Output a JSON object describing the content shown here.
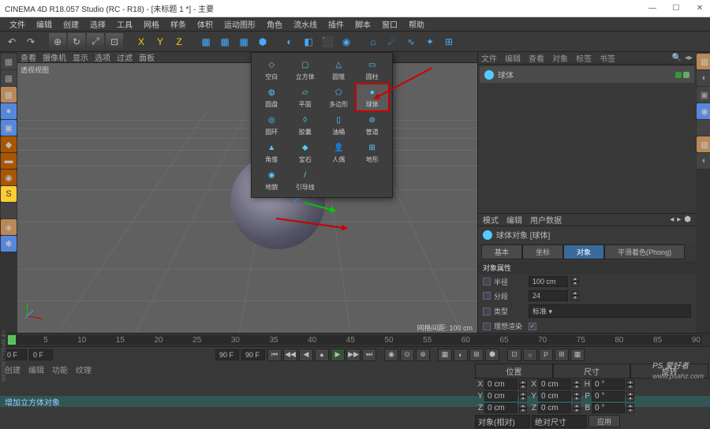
{
  "title": "CINEMA 4D R18.057 Studio (RC - R18) - [未标题 1 *] - 主要",
  "winbtns": {
    "min": "—",
    "max": "☐",
    "close": "✕"
  },
  "menus": [
    "文件",
    "编辑",
    "创建",
    "选择",
    "工具",
    "网格",
    "样条",
    "体积",
    "运动图形",
    "角色",
    "流水线",
    "插件",
    "脚本",
    "窗口",
    "帮助"
  ],
  "toolbar_icons": [
    "↶",
    "↷",
    "",
    "⊕",
    "↻",
    "⤢",
    "⊡",
    "",
    "X",
    "Y",
    "Z",
    "",
    "▦",
    "▦",
    "▦",
    "⬢",
    "",
    "◐",
    "◧",
    "⬛",
    "◉",
    "",
    "⌂",
    "☄",
    "∿",
    "✦",
    "⊞"
  ],
  "left_icons": [
    {
      "c": "c1",
      "t": "▦"
    },
    {
      "c": "c1",
      "t": "▦"
    },
    {
      "c": "c2",
      "t": "▦"
    },
    {
      "c": "c3",
      "t": "●"
    },
    {
      "c": "c3",
      "t": "▣"
    },
    {
      "c": "c4",
      "t": "◆"
    },
    {
      "c": "c4",
      "t": "▬"
    },
    {
      "c": "c4",
      "t": "◉"
    },
    {
      "c": "c5",
      "t": "S"
    },
    {
      "c": "c1",
      "t": ""
    },
    {
      "c": "c2",
      "t": "◈"
    },
    {
      "c": "c3",
      "t": "✱"
    }
  ],
  "right_icons": [
    {
      "c": "c2",
      "t": "▦"
    },
    {
      "c": "c1",
      "t": "◐"
    },
    {
      "c": "c1",
      "t": "▣"
    },
    {
      "c": "c3",
      "t": "◉"
    },
    {
      "c": "c1",
      "t": ""
    },
    {
      "c": "c2",
      "t": "▦"
    },
    {
      "c": "c1",
      "t": "◐"
    }
  ],
  "view_menu": [
    "查看",
    "摄像机",
    "显示",
    "选项",
    "过滤",
    "面板"
  ],
  "view_label": "透视视图",
  "view_footer": "网格间距: 100 cm",
  "primitives": [
    {
      "ico": "◇",
      "lbl": "空白"
    },
    {
      "ico": "▢",
      "lbl": "立方体"
    },
    {
      "ico": "△",
      "lbl": "圆锥"
    },
    {
      "ico": "▭",
      "lbl": "圆柱"
    },
    {
      "ico": "◍",
      "lbl": "圆盘"
    },
    {
      "ico": "▱",
      "lbl": "平面"
    },
    {
      "ico": "⬠",
      "lbl": "多边形"
    },
    {
      "ico": "●",
      "lbl": "球体",
      "hl": true
    },
    {
      "ico": "◎",
      "lbl": "圆环"
    },
    {
      "ico": "◊",
      "lbl": "胶囊"
    },
    {
      "ico": "▯",
      "lbl": "油桶"
    },
    {
      "ico": "⊚",
      "lbl": "管道"
    },
    {
      "ico": "▲",
      "lbl": "角锥"
    },
    {
      "ico": "◆",
      "lbl": "宝石"
    },
    {
      "ico": "👤",
      "lbl": "人偶"
    },
    {
      "ico": "⊞",
      "lbl": "地形"
    },
    {
      "ico": "◉",
      "lbl": "地貌"
    },
    {
      "ico": "/",
      "lbl": "引导线"
    }
  ],
  "obj_tabs": [
    "文件",
    "编辑",
    "查看",
    "对象",
    "标签",
    "书签"
  ],
  "obj_name": "球体",
  "attr_tabs_top": [
    "模式",
    "编辑",
    "用户数据"
  ],
  "attr_title": "球体对象 [球体]",
  "attr_tabs": [
    {
      "t": "基本"
    },
    {
      "t": "坐标"
    },
    {
      "t": "对象",
      "act": true
    },
    {
      "t": "平滑着色(Phong)"
    }
  ],
  "section": "对象属性",
  "props": [
    {
      "lbl": "半径",
      "val": "100 cm",
      "chk": true,
      "spin": true
    },
    {
      "lbl": "分段",
      "val": "24",
      "chk": true,
      "spin": true
    },
    {
      "lbl": "类型",
      "val": "标准",
      "chk": true,
      "sel": true
    },
    {
      "lbl": "理想渲染",
      "val": "✓",
      "chk": true,
      "check": true
    }
  ],
  "timeline": {
    "ticks": [
      "0",
      "5",
      "10",
      "15",
      "20",
      "25",
      "30",
      "35",
      "40",
      "45",
      "50",
      "55",
      "60",
      "65",
      "70",
      "75",
      "80",
      "85",
      "90"
    ]
  },
  "tctrl": {
    "start": "0 F",
    "cur": "0 F",
    "end": "90 F",
    "end2": "90 F"
  },
  "tbtns": [
    "⏮",
    "◀◀",
    "◀",
    "●",
    "▶",
    "▶▶",
    "⏭",
    "",
    "◉",
    "⊙",
    "⊕",
    "",
    "▦",
    "◐",
    "⊞",
    "⬢",
    "",
    "⊡",
    "○",
    "P",
    "⊞",
    "▦"
  ],
  "lower_tabs": [
    "创建",
    "编辑",
    "功能",
    "纹理"
  ],
  "coord_hdrs": [
    "位置",
    "尺寸",
    "旋转"
  ],
  "coords": [
    {
      "a": "X",
      "p": "0 cm",
      "s": "0 cm",
      "r": "0 °"
    },
    {
      "a": "Y",
      "p": "0 cm",
      "s": "0 cm",
      "r": "0 °"
    },
    {
      "a": "Z",
      "p": "0 cm",
      "s": "0 cm",
      "r": "0 °"
    }
  ],
  "coord_btn": "应用",
  "coord_mode1": "对象(相对)",
  "coord_mode2": "绝对尺寸",
  "status": "增加立方体对象",
  "watermark": {
    "main": "PS 爱好者",
    "sub": "www.psahz.com"
  },
  "brand": "MAXON CINEMA 4D"
}
